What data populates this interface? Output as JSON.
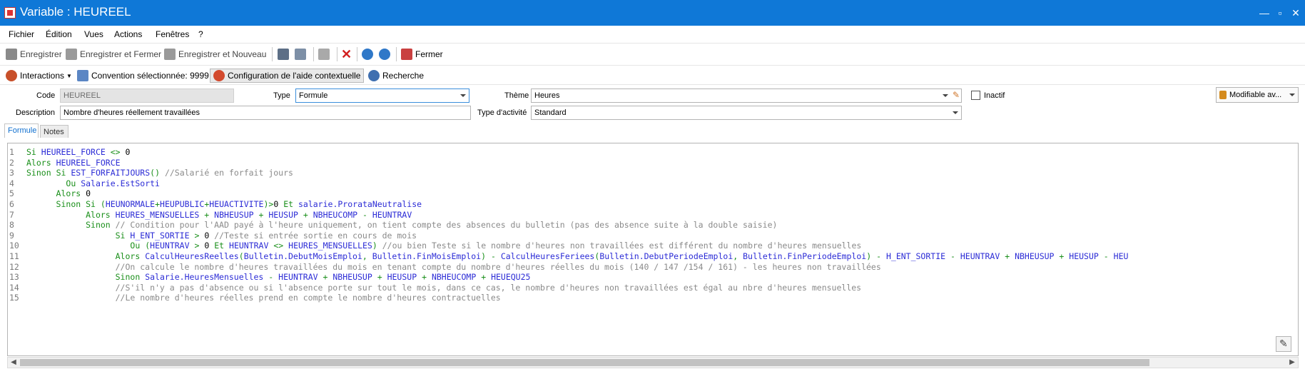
{
  "window": {
    "title": "Variable : HEUREEL"
  },
  "menu": [
    "Fichier",
    "Édition",
    "Vues",
    "Actions",
    "Fenêtres",
    "?"
  ],
  "toolbar": {
    "save": "Enregistrer",
    "save_close": "Enregistrer et Fermer",
    "save_new": "Enregistrer et Nouveau",
    "close": "Fermer"
  },
  "toolbar2": {
    "interactions": "Interactions",
    "convention": "Convention sélectionnée: 9999",
    "help_config": "Configuration de l'aide contextuelle",
    "search": "Recherche"
  },
  "form": {
    "code_label": "Code",
    "code_value": "HEUREEL",
    "type_label": "Type",
    "type_value": "Formule",
    "theme_label": "Thème",
    "theme_value": "Heures",
    "inactif_label": "Inactif",
    "modifiable_label": "Modifiable av...",
    "description_label": "Description",
    "description_value": "Nombre d'heures réellement travaillées",
    "activity_label": "Type d'activité",
    "activity_value": "Standard"
  },
  "tabs": [
    "Formule",
    "Notes"
  ],
  "code_lines": [
    "Si HEUREEL_FORCE <> 0",
    "Alors HEUREEL_FORCE",
    "Sinon Si EST_FORFAITJOURS() //Salarié en forfait jours",
    "        Ou Salarie.EstSorti",
    "      Alors 0",
    "      Sinon Si (HEUNORMALE+HEUPUBLIC+HEUACTIVITE)>0 Et salarie.ProrataNeutralise",
    "            Alors HEURES_MENSUELLES + NBHEUSUP + HEUSUP + NBHEUCOMP - HEUNTRAV",
    "            Sinon // Condition pour l'AAD payé à l'heure uniquement, on tient compte des absences du bulletin (pas des absence suite à la double saisie)",
    "                  Si H_ENT_SORTIE > 0 //Teste si entrée sortie en cours de mois",
    "                     Ou (HEUNTRAV > 0 Et HEUNTRAV <> HEURES_MENSUELLES) //ou bien Teste si le nombre d'heures non travaillées est différent du nombre d'heures mensuelles",
    "                  Alors CalculHeuresReelles(Bulletin.DebutMoisEmploi, Bulletin.FinMoisEmploi) - CalculHeuresFeriees(Bulletin.DebutPeriodeEmploi, Bulletin.FinPeriodeEmploi) - H_ENT_SORTIE - HEUNTRAV + NBHEUSUP + HEUSUP - HEU",
    "                  //On calcule le nombre d'heures travaillées du mois en tenant compte du nombre d'heures réelles du mois (140 / 147 /154 / 161) - les heures non travaillées",
    "                  Sinon Salarie.HeuresMensuelles - HEUNTRAV + NBHEUSUP + HEUSUP + NBHEUCOMP + HEUEQU25",
    "                  //S'il n'y a pas d'absence ou si l'absence porte sur tout le mois, dans ce cas, le nombre d'heures non travaillées est égal au nbre d'heures mensuelles",
    "                  //Le nombre d'heures réelles prend en compte le nombre d'heures contractuelles"
  ]
}
